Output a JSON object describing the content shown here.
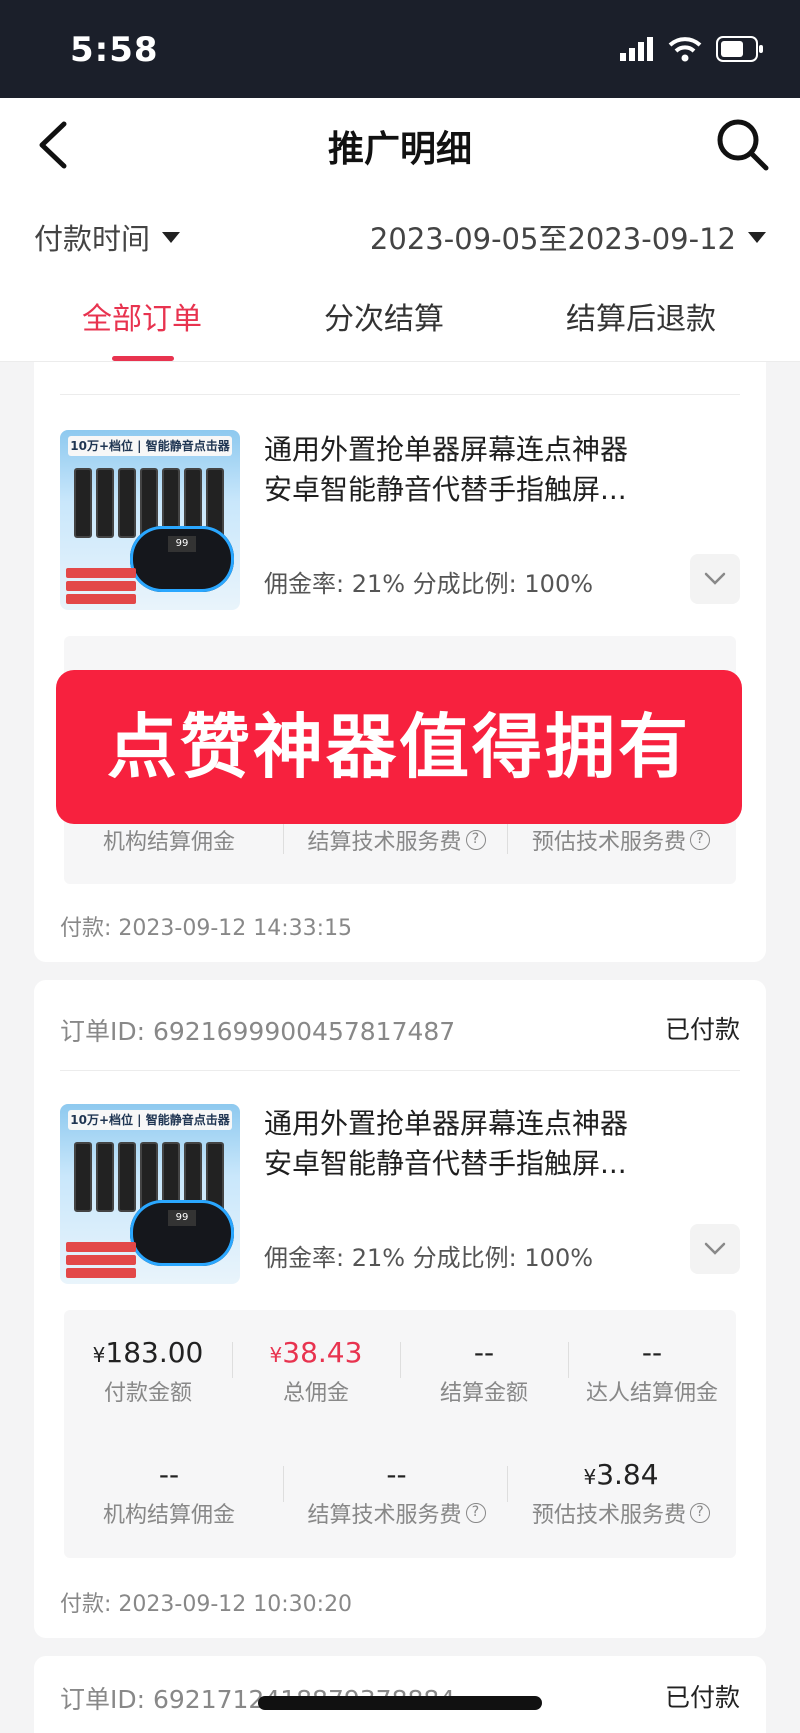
{
  "status_bar": {
    "time": "5:58"
  },
  "header": {
    "title": "推广明细",
    "filter_time_label": "付款时间",
    "date_range": "2023-09-05至2023-09-12",
    "tabs": [
      {
        "label": "全部订单",
        "active": true
      },
      {
        "label": "分次结算",
        "active": false
      },
      {
        "label": "结算后退款",
        "active": false
      }
    ]
  },
  "product": {
    "title_line1": "通用外置抢单器屏幕连点神器",
    "title_line2": "安卓智能静音代替手指触屏...",
    "rate_text": "佣金率: 21%   分成比例: 100%",
    "thumb_banner": "10万+档位 | 智能静音点击器",
    "thumb_screen": "99"
  },
  "cards": [
    {
      "stats_row2_labels": [
        "机构结算佣金",
        "结算技术服务费",
        "预估技术服务费"
      ],
      "pay_time": "付款: 2023-09-12 14:33:15"
    },
    {
      "order_id": "订单ID: 6921699900457817487",
      "status": "已付款",
      "stats_row1": [
        {
          "value": "183.00",
          "currency": "¥",
          "label": "付款金额"
        },
        {
          "value": "38.43",
          "currency": "¥",
          "label": "总佣金"
        },
        {
          "value": "--",
          "label": "结算金额"
        },
        {
          "value": "--",
          "label": "达人结算佣金"
        }
      ],
      "stats_row2": [
        {
          "value": "--",
          "label": "机构结算佣金"
        },
        {
          "value": "--",
          "label": "结算技术服务费"
        },
        {
          "value": "3.84",
          "currency": "¥",
          "label": "预估技术服务费"
        }
      ],
      "pay_time": "付款: 2023-09-12 10:30:20"
    },
    {
      "order_id": "订单ID: 6921712418879378884",
      "status": "已付款"
    }
  ],
  "overlay_text": "点赞神器值得拥有",
  "colors": {
    "accent": "#e8334f",
    "banner": "#f7213e",
    "status_bar": "#1b1f2a"
  }
}
